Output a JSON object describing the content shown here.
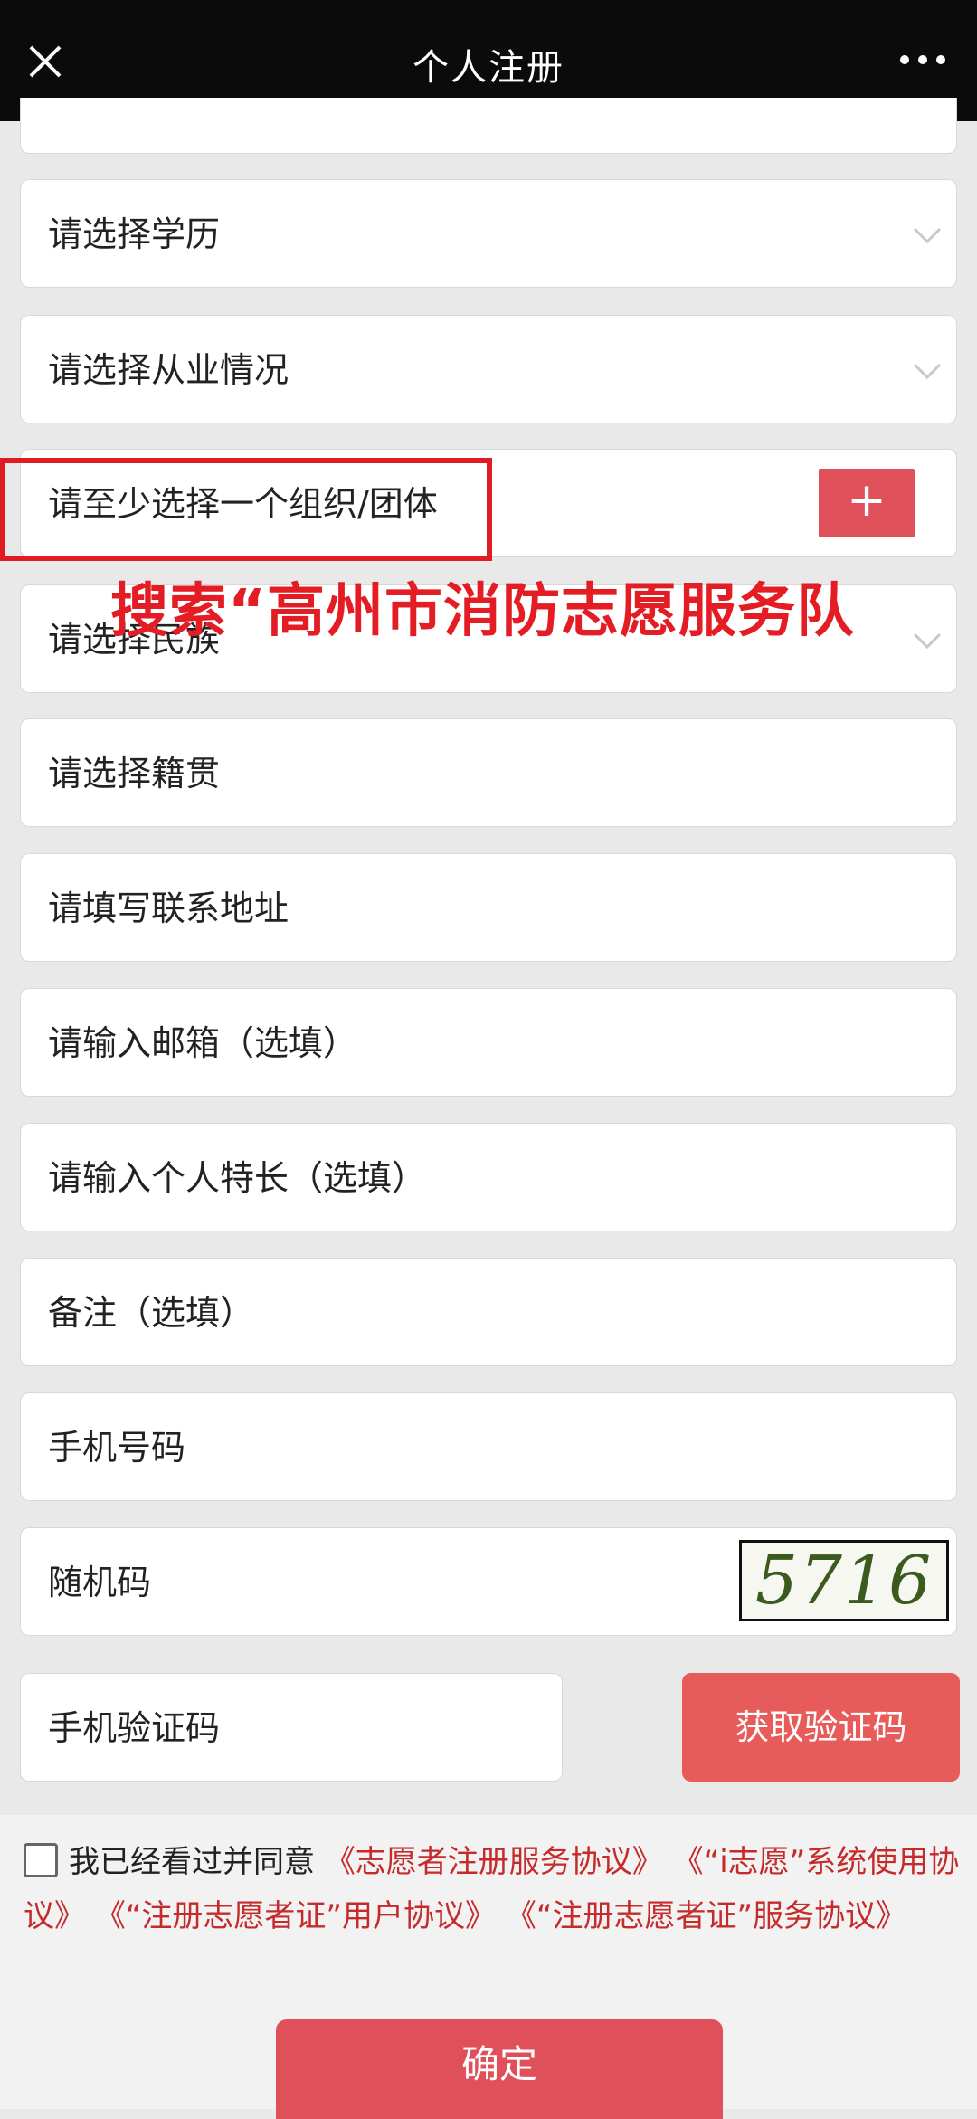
{
  "header": {
    "title": "个人注册",
    "close_icon": "close-icon",
    "more_icon": "more-icon"
  },
  "form": {
    "education": "请选择学历",
    "employment": "请选择从业情况",
    "organization": "请至少选择一个组织/团体",
    "organization_add": "+",
    "overlay_hint": "搜索“高州市消防志愿服务队",
    "ethnicity": "请选择民族",
    "native_place": "请选择籍贯",
    "address": "请填写联系地址",
    "email": "请输入邮箱（选填）",
    "specialty": "请输入个人特长（选填）",
    "remarks": "备注（选填）",
    "phone": "手机号码",
    "random_code": "随机码",
    "captcha_value": "5716",
    "sms_code": "手机验证码",
    "sms_button": "获取验证码"
  },
  "agreement": {
    "text": "我已经看过并同意",
    "link1": "《志愿者注册服务协议》",
    "link2": "《“i志愿”系统使用协议》",
    "link3": "《“注册志愿者证”用户协议》",
    "link4": "《“注册志愿者证”服务协议》"
  },
  "confirm_button": "确定",
  "colors": {
    "accent": "#e0505a",
    "highlight": "#e11b22",
    "link": "#c62b2b"
  }
}
